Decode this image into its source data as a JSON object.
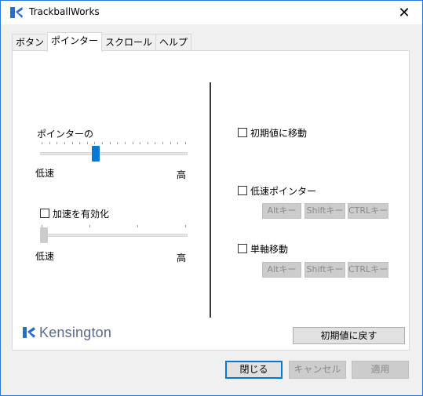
{
  "window": {
    "title": "TrackballWorks",
    "close_glyph": "✕"
  },
  "tabs": [
    {
      "label": "ボタン",
      "active": false
    },
    {
      "label": "ポインター",
      "active": true
    },
    {
      "label": "スクロール",
      "active": false
    },
    {
      "label": "ヘルプ",
      "active": false
    }
  ],
  "pointer": {
    "speed_label": "ポインターの",
    "speed_low": "低速",
    "speed_high": "高",
    "speed_value": 0.37,
    "accel_checkbox_label": "加速を有効化",
    "accel_checked": false,
    "accel_low": "低速",
    "accel_high": "高",
    "accel_value": 0.0
  },
  "options": {
    "snap_to_default_label": "初期値に移動",
    "snap_to_default_checked": false,
    "slow_pointer_label": "低速ポインター",
    "slow_pointer_checked": false,
    "single_axis_label": "単軸移動",
    "single_axis_checked": false,
    "key_buttons_1": [
      "Altキー",
      "Shiftキー",
      "CTRLキー"
    ],
    "key_buttons_2": [
      "Altキー",
      "Shiftキー",
      "CTRLキー"
    ]
  },
  "brand": {
    "logo_text": "Kensington"
  },
  "reset_button": "初期値に戻す",
  "footer": {
    "close": "閉じる",
    "cancel": "キャンセル",
    "apply": "適用"
  },
  "colors": {
    "accent": "#0078d7",
    "disabled_bg": "#cccccc",
    "disabled_text": "#8a8a8a"
  }
}
